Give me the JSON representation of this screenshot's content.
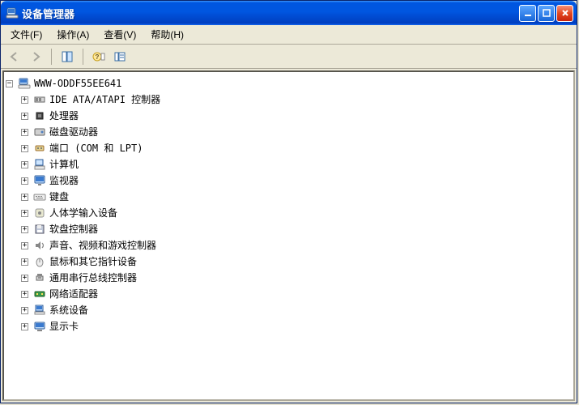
{
  "window": {
    "title": "设备管理器"
  },
  "menubar": {
    "file": "文件(F)",
    "action": "操作(A)",
    "view": "查看(V)",
    "help": "帮助(H)"
  },
  "tree": {
    "root": "WWW-ODDF55EE641",
    "nodes": [
      {
        "icon": "ide",
        "label": "IDE ATA/ATAPI 控制器"
      },
      {
        "icon": "cpu",
        "label": "处理器"
      },
      {
        "icon": "disk",
        "label": "磁盘驱动器"
      },
      {
        "icon": "port",
        "label": "端口 (COM 和 LPT)"
      },
      {
        "icon": "computer",
        "label": "计算机"
      },
      {
        "icon": "monitor",
        "label": "监视器"
      },
      {
        "icon": "keyboard",
        "label": "键盘"
      },
      {
        "icon": "hid",
        "label": "人体学输入设备"
      },
      {
        "icon": "floppy",
        "label": "软盘控制器"
      },
      {
        "icon": "sound",
        "label": "声音、视频和游戏控制器"
      },
      {
        "icon": "mouse",
        "label": "鼠标和其它指针设备"
      },
      {
        "icon": "usb",
        "label": "通用串行总线控制器"
      },
      {
        "icon": "network",
        "label": "网络适配器"
      },
      {
        "icon": "system",
        "label": "系统设备"
      },
      {
        "icon": "display",
        "label": "显示卡"
      }
    ]
  }
}
